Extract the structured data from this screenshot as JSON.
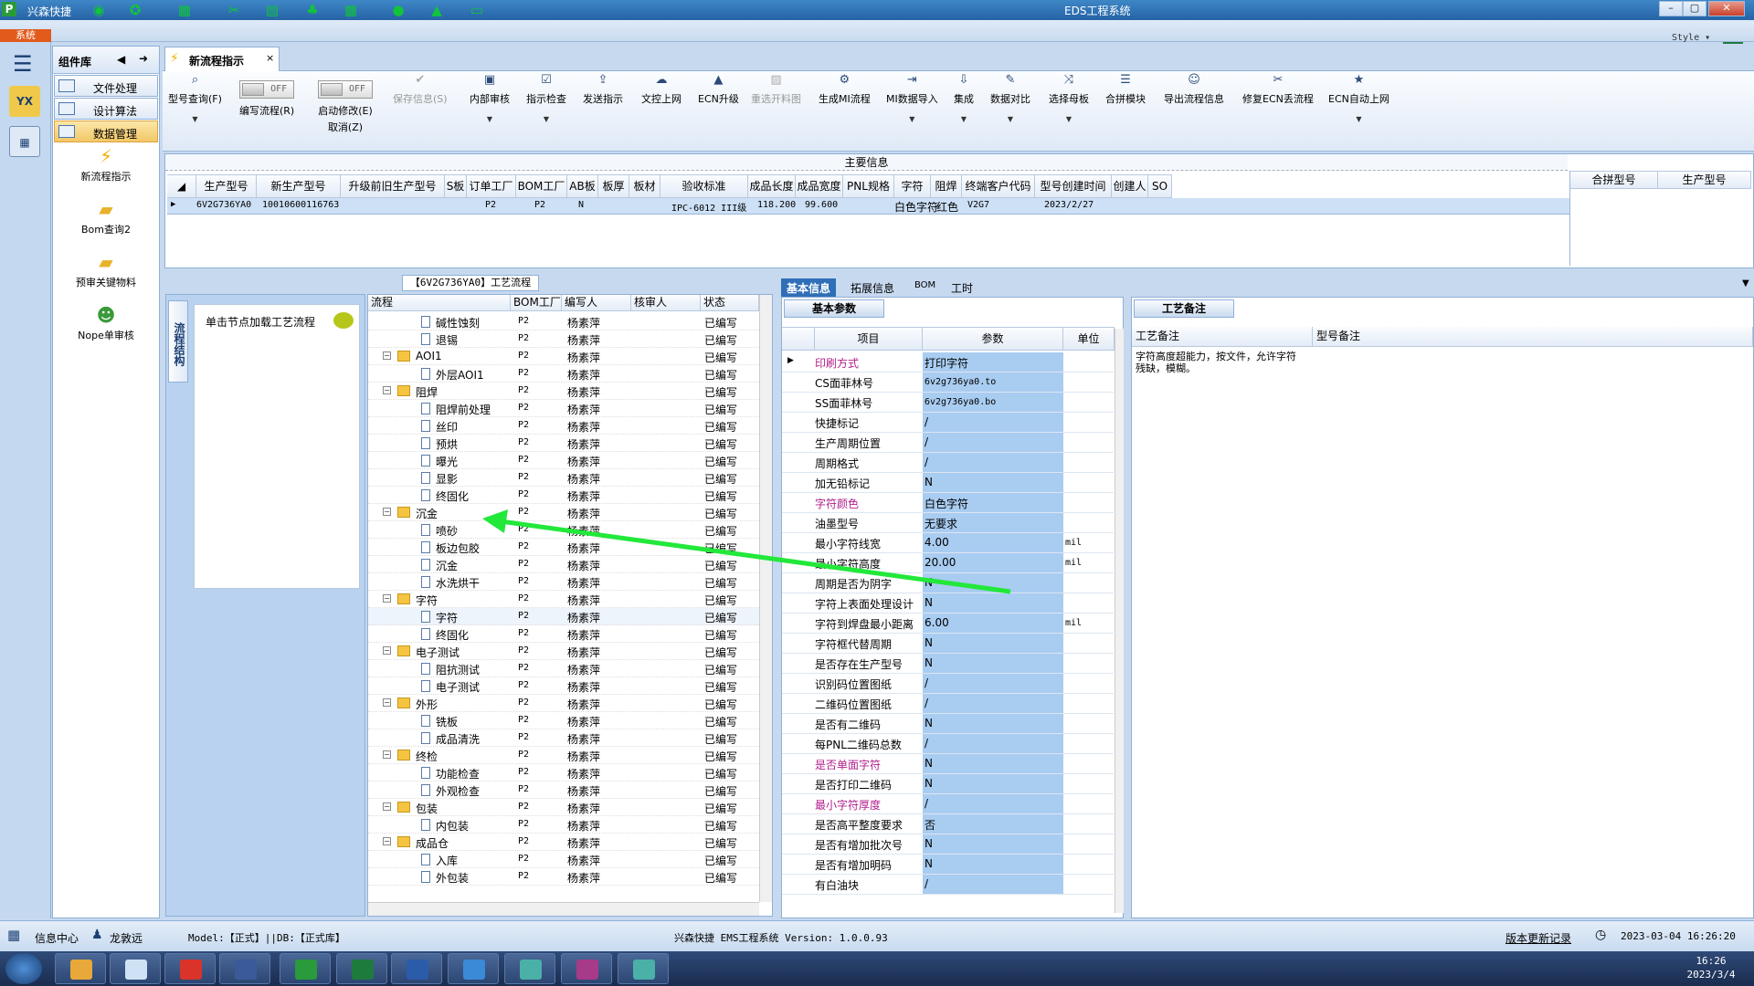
{
  "titlebar": {
    "app_name": "兴森快捷",
    "window_title": "EDS工程系统",
    "minimize": "–",
    "maximize": "▢",
    "close": "✕"
  },
  "sysbar": {
    "system_tab": "系统",
    "style_label": "Style ▾"
  },
  "sidebar": {
    "header": "组件库",
    "items": [
      {
        "label": "文件处理"
      },
      {
        "label": "设计算法"
      },
      {
        "label": "数据管理"
      }
    ],
    "tools": [
      {
        "label": "新流程指示",
        "icon": "lightning-icon"
      },
      {
        "label": "Bom查询2",
        "icon": "folder-icon"
      },
      {
        "label": "预审关键物料",
        "icon": "folder-icon"
      },
      {
        "label": "Nope单审核",
        "icon": "user-icon"
      }
    ],
    "yx_label": "YX"
  },
  "tab": {
    "label": "新流程指示",
    "close": "×"
  },
  "toolbar": {
    "items": [
      {
        "label": "型号查询(F)"
      },
      {
        "label": "编写流程(R)",
        "toggle": "OFF"
      },
      {
        "label": "启动修改(E)",
        "sub": "取消(Z)",
        "toggle": "OFF"
      },
      {
        "label": "保存信息(S)"
      },
      {
        "label": "内部审核"
      },
      {
        "label": "指示检查"
      },
      {
        "label": "发送指示"
      },
      {
        "label": "文控上网"
      },
      {
        "label": "ECN升级"
      },
      {
        "label": "重选开料图"
      },
      {
        "label": "生成MI流程"
      },
      {
        "label": "MI数据导入"
      },
      {
        "label": "集成"
      },
      {
        "label": "数据对比"
      },
      {
        "label": "选择母板"
      },
      {
        "label": "合拼模块"
      },
      {
        "label": "导出流程信息"
      },
      {
        "label": "修复ECN丢流程"
      },
      {
        "label": "ECN自动上网"
      }
    ]
  },
  "main_info": {
    "caption": "主要信息",
    "columns": [
      "生产型号",
      "新生产型号",
      "升级前旧生产型号",
      "S板",
      "订单工厂",
      "BOM工厂",
      "AB板",
      "板厚",
      "板材",
      "验收标准",
      "成品长度",
      "成品宽度",
      "PNL规格",
      "字符",
      "阻焊",
      "终端客户代码",
      "型号创建时间",
      "创建人",
      "SO"
    ],
    "row": {
      "prod_model": "6V2G736YA0",
      "new_model": "10010600116763",
      "order_factory": "P2",
      "bom_factory": "P2",
      "ab": "N",
      "standard": "IPC-6012 III级",
      "length": "118.200",
      "width": "99.600",
      "char": "白色字符",
      "solder": "红色",
      "customer": "V2G7",
      "created": "2023/2/27"
    },
    "right_columns": [
      "合拼型号",
      "生产型号"
    ]
  },
  "left_panel": {
    "vertical_tab": "流程结构",
    "hint": "单击节点加载工艺流程"
  },
  "flow": {
    "caption": "【6V2G736YA0】工艺流程",
    "columns": [
      "流程",
      "BOM工厂",
      "编写人",
      "核审人",
      "状态"
    ],
    "rows": [
      {
        "name": "碱性蚀刻",
        "level": 2,
        "fac": "P2",
        "writer": "杨素萍",
        "status": "已编写"
      },
      {
        "name": "退锡",
        "level": 2,
        "fac": "P2",
        "writer": "杨素萍",
        "status": "已编写"
      },
      {
        "name": "AOI1",
        "level": 1,
        "fac": "P2",
        "writer": "杨素萍",
        "status": "已编写"
      },
      {
        "name": "外层AOI1",
        "level": 2,
        "fac": "P2",
        "writer": "杨素萍",
        "status": "已编写"
      },
      {
        "name": "阻焊",
        "level": 1,
        "fac": "P2",
        "writer": "杨素萍",
        "status": "已编写"
      },
      {
        "name": "阻焊前处理",
        "level": 2,
        "fac": "P2",
        "writer": "杨素萍",
        "status": "已编写"
      },
      {
        "name": "丝印",
        "level": 2,
        "fac": "P2",
        "writer": "杨素萍",
        "status": "已编写"
      },
      {
        "name": "预烘",
        "level": 2,
        "fac": "P2",
        "writer": "杨素萍",
        "status": "已编写"
      },
      {
        "name": "曝光",
        "level": 2,
        "fac": "P2",
        "writer": "杨素萍",
        "status": "已编写"
      },
      {
        "name": "显影",
        "level": 2,
        "fac": "P2",
        "writer": "杨素萍",
        "status": "已编写"
      },
      {
        "name": "终固化",
        "level": 2,
        "fac": "P2",
        "writer": "杨素萍",
        "status": "已编写"
      },
      {
        "name": "沉金",
        "level": 1,
        "fac": "P2",
        "writer": "杨素萍",
        "status": "已编写"
      },
      {
        "name": "喷砂",
        "level": 2,
        "fac": "P2",
        "writer": "杨素萍",
        "status": "已编写"
      },
      {
        "name": "板边包胶",
        "level": 2,
        "fac": "P2",
        "writer": "杨素萍",
        "status": "已编写"
      },
      {
        "name": "沉金",
        "level": 2,
        "fac": "P2",
        "writer": "杨素萍",
        "status": "已编写"
      },
      {
        "name": "水洗烘干",
        "level": 2,
        "fac": "P2",
        "writer": "杨素萍",
        "status": "已编写"
      },
      {
        "name": "字符",
        "level": 1,
        "fac": "P2",
        "writer": "杨素萍",
        "status": "已编写"
      },
      {
        "name": "字符",
        "level": 2,
        "fac": "P2",
        "writer": "杨素萍",
        "status": "已编写"
      },
      {
        "name": "终固化",
        "level": 2,
        "fac": "P2",
        "writer": "杨素萍",
        "status": "已编写"
      },
      {
        "name": "电子测试",
        "level": 1,
        "fac": "P2",
        "writer": "杨素萍",
        "status": "已编写"
      },
      {
        "name": "阻抗测试",
        "level": 2,
        "fac": "P2",
        "writer": "杨素萍",
        "status": "已编写"
      },
      {
        "name": "电子测试",
        "level": 2,
        "fac": "P2",
        "writer": "杨素萍",
        "status": "已编写"
      },
      {
        "name": "外形",
        "level": 1,
        "fac": "P2",
        "writer": "杨素萍",
        "status": "已编写"
      },
      {
        "name": "铣板",
        "level": 2,
        "fac": "P2",
        "writer": "杨素萍",
        "status": "已编写"
      },
      {
        "name": "成品清洗",
        "level": 2,
        "fac": "P2",
        "writer": "杨素萍",
        "status": "已编写"
      },
      {
        "name": "终检",
        "level": 1,
        "fac": "P2",
        "writer": "杨素萍",
        "status": "已编写"
      },
      {
        "name": "功能检查",
        "level": 2,
        "fac": "P2",
        "writer": "杨素萍",
        "status": "已编写"
      },
      {
        "name": "外观检查",
        "level": 2,
        "fac": "P2",
        "writer": "杨素萍",
        "status": "已编写"
      },
      {
        "name": "包装",
        "level": 1,
        "fac": "P2",
        "writer": "杨素萍",
        "status": "已编写"
      },
      {
        "name": "内包装",
        "level": 2,
        "fac": "P2",
        "writer": "杨素萍",
        "status": "已编写"
      },
      {
        "name": "成品仓",
        "level": 1,
        "fac": "P2",
        "writer": "杨素萍",
        "status": "已编写"
      },
      {
        "name": "入库",
        "level": 2,
        "fac": "P2",
        "writer": "杨素萍",
        "status": "已编写"
      },
      {
        "name": "外包装",
        "level": 2,
        "fac": "P2",
        "writer": "杨素萍",
        "status": "已编写"
      }
    ]
  },
  "info_tabs": [
    "基本信息",
    "拓展信息",
    "BOM",
    "工时"
  ],
  "basic": {
    "sub_tab": "基本参数",
    "columns": [
      "项目",
      "参数",
      "单位"
    ],
    "rows": [
      {
        "k": "印刷方式",
        "v": "打印字符",
        "u": "",
        "mag": true
      },
      {
        "k": "CS面菲林号",
        "v": "6v2g736ya0.to",
        "u": "",
        "mono": true
      },
      {
        "k": "SS面菲林号",
        "v": "6v2g736ya0.bo",
        "u": "",
        "mono": true
      },
      {
        "k": "快捷标记",
        "v": "/",
        "u": ""
      },
      {
        "k": "生产周期位置",
        "v": "/",
        "u": ""
      },
      {
        "k": "周期格式",
        "v": "/",
        "u": ""
      },
      {
        "k": "加无铅标记",
        "v": "N",
        "u": ""
      },
      {
        "k": "字符颜色",
        "v": "白色字符",
        "u": "",
        "mag": true
      },
      {
        "k": "油墨型号",
        "v": "无要求",
        "u": ""
      },
      {
        "k": "最小字符线宽",
        "v": "4.00",
        "u": "mil"
      },
      {
        "k": "最小字符高度",
        "v": "20.00",
        "u": "mil"
      },
      {
        "k": "周期是否为阴字",
        "v": "N",
        "u": ""
      },
      {
        "k": "字符上表面处理设计",
        "v": "N",
        "u": ""
      },
      {
        "k": "字符到焊盘最小距离",
        "v": "6.00",
        "u": "mil"
      },
      {
        "k": "字符框代替周期",
        "v": "N",
        "u": ""
      },
      {
        "k": "是否存在生产型号",
        "v": "N",
        "u": ""
      },
      {
        "k": "识别码位置图纸",
        "v": "/",
        "u": ""
      },
      {
        "k": "二维码位置图纸",
        "v": "/",
        "u": ""
      },
      {
        "k": "是否有二维码",
        "v": "N",
        "u": ""
      },
      {
        "k": "每PNL二维码总数",
        "v": "/",
        "u": ""
      },
      {
        "k": "是否单面字符",
        "v": "N",
        "u": "",
        "mag": true
      },
      {
        "k": "是否打印二维码",
        "v": "N",
        "u": ""
      },
      {
        "k": "最小字符厚度",
        "v": "/",
        "u": "",
        "mag": true
      },
      {
        "k": "是否高平整度要求",
        "v": "否",
        "u": ""
      },
      {
        "k": "是否有增加批次号",
        "v": "N",
        "u": ""
      },
      {
        "k": "是否有增加明码",
        "v": "N",
        "u": ""
      },
      {
        "k": "有白油块",
        "v": "/",
        "u": ""
      }
    ]
  },
  "remarks": {
    "sub_tab": "工艺备注",
    "col1": "工艺备注",
    "col2": "型号备注",
    "text": "字符高度超能力，按文件，允许字符残缺，模糊。"
  },
  "statusbar": {
    "info_center": "信息中心",
    "user": "龙敦远",
    "model_db": "Model:【正式】||DB:【正式库】",
    "version": "兴森快捷 EMS工程系统 Version: 1.0.0.93",
    "update_log": "版本更新记录",
    "datetime": "2023-03-04 16:26:20"
  },
  "taskbar": {
    "time": "16:26",
    "date": "2023/3/4"
  },
  "colors": {
    "accent": "#2f6fb7",
    "selected_row": "#cde0f6",
    "param_bg": "#a9ccf1",
    "magenta_label": "#b01f8c",
    "arrow": "#22e83a"
  }
}
